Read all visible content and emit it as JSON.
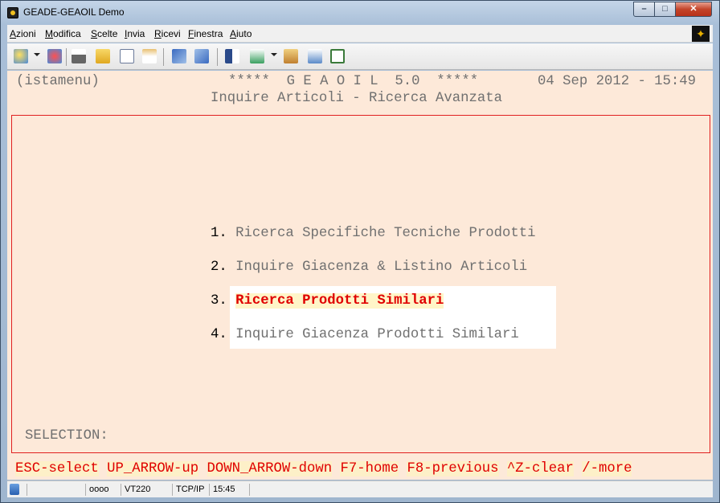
{
  "window": {
    "title": "GEADE-GEAOIL Demo"
  },
  "menubar": {
    "items": [
      {
        "accel": "A",
        "rest": "zioni"
      },
      {
        "accel": "M",
        "rest": "odifica"
      },
      {
        "accel": "S",
        "rest": "celte"
      },
      {
        "accel": "I",
        "rest": "nvia"
      },
      {
        "accel": "R",
        "rest": "icevi"
      },
      {
        "accel": "F",
        "rest": "inestra"
      },
      {
        "accel": "A",
        "rest": "iuto"
      }
    ]
  },
  "toolbar": {
    "icons": [
      "new-session-icon",
      "disconnect-icon",
      "print-icon",
      "open-folder-icon",
      "copy-icon",
      "paste-icon",
      "send-icon",
      "receive-icon",
      "book-icon",
      "font-icon",
      "setup-icon",
      "edit-icon",
      "screen-icon"
    ]
  },
  "terminal": {
    "program": "(istamenu)",
    "banner": "*****  G E A O I L  5.0  *****",
    "datetime": "04 Sep 2012 - 15:49",
    "subtitle": "Inquire Articoli - Ricerca Avanzata",
    "options": [
      {
        "num": "1.",
        "label": "Ricerca Specifiche Tecniche Prodotti"
      },
      {
        "num": "2.",
        "label": "Inquire Giacenza & Listino Articoli"
      },
      {
        "num": "3.",
        "label": "Ricerca Prodotti Similari"
      },
      {
        "num": "4.",
        "label": "Inquire Giacenza Prodotti Similari"
      }
    ],
    "selected_index": 2,
    "selection_label": "SELECTION:",
    "function_keys": [
      "ESC-select",
      "UP_ARROW-up",
      "DOWN_ARROW-down",
      "F7-home",
      "F8-previous",
      "^Z-clear",
      "/-more"
    ]
  },
  "statusbar": {
    "indicators": "oooo",
    "emulation": "VT220",
    "protocol": "TCP/IP",
    "time": "15:45"
  },
  "colors": {
    "terminal_bg": "#fde9d9",
    "frame": "#e02020",
    "highlight_text": "#e00000",
    "normal_text": "#707070"
  }
}
